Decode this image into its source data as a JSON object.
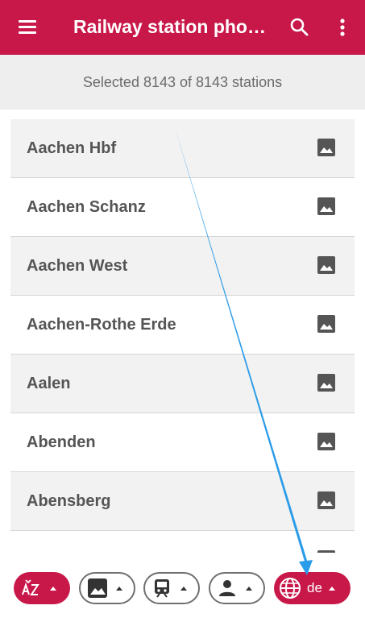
{
  "toolbar": {
    "title": "Railway station pho…",
    "menu_icon": "menu-icon",
    "search_icon": "search-icon",
    "more_icon": "more-vert-icon",
    "color": "#c8184a"
  },
  "selection": {
    "text": "Selected 8143 of 8143 stations"
  },
  "stations": [
    {
      "name": "Aachen Hbf",
      "icon": "photo-icon"
    },
    {
      "name": "Aachen Schanz",
      "icon": "photo-icon"
    },
    {
      "name": "Aachen West",
      "icon": "photo-icon"
    },
    {
      "name": "Aachen-Rothe Erde",
      "icon": "photo-icon"
    },
    {
      "name": "Aalen",
      "icon": "photo-icon"
    },
    {
      "name": "Abenden",
      "icon": "photo-icon"
    },
    {
      "name": "Abensberg",
      "icon": "photo-icon"
    }
  ],
  "filters": {
    "sort": {
      "icon": "sort-az-icon",
      "active": true
    },
    "photo": {
      "icon": "photo-icon",
      "active": false
    },
    "active_station": {
      "icon": "train-icon",
      "active": false
    },
    "nickname": {
      "icon": "person-icon",
      "active": false
    },
    "country": {
      "icon": "globe-icon",
      "label": "de",
      "active": true
    }
  }
}
